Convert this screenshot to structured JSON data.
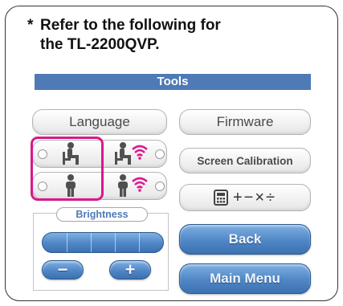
{
  "note": {
    "star": "*",
    "line1": "Refer to the following for",
    "line2": "the TL-2200QVP."
  },
  "toolbar": {
    "title": "Tools"
  },
  "buttons": {
    "language": "Language",
    "firmware": "Firmware",
    "screen_calibration": "Screen Calibration",
    "math_symbols": "+−×÷",
    "back": "Back",
    "main_menu": "Main Menu"
  },
  "brightness": {
    "label": "Brightness",
    "minus": "−",
    "plus": "+",
    "level_segments": 5
  },
  "colors": {
    "header": "#4e7ab6",
    "highlight": "#d8188c",
    "wifi": "#e0198f",
    "blue_button": "#4f86c6"
  }
}
